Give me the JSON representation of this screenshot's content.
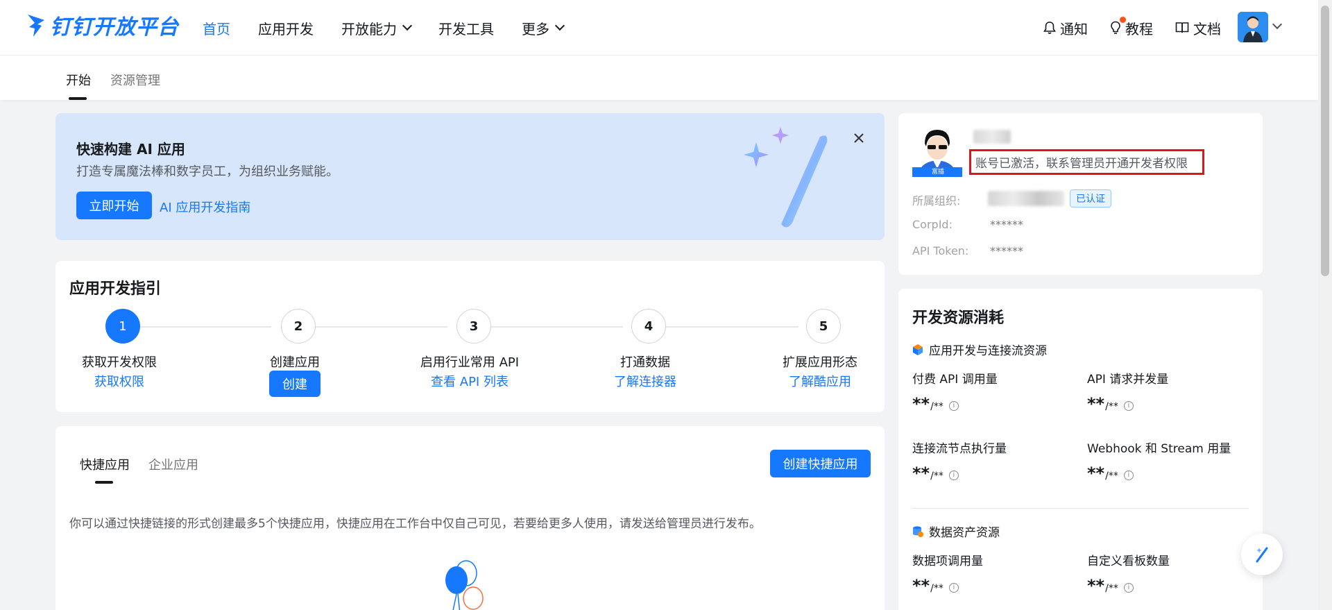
{
  "brand": {
    "name": "钉钉开放平台"
  },
  "nav": {
    "items": [
      {
        "label": "首页",
        "active": true
      },
      {
        "label": "应用开发"
      },
      {
        "label": "开放能力"
      },
      {
        "label": "开发工具"
      },
      {
        "label": "更多"
      }
    ],
    "right": {
      "notify": "通知",
      "tutorial": "教程",
      "docs": "文档"
    }
  },
  "subnav": {
    "tabs": [
      "开始",
      "资源管理"
    ]
  },
  "banner": {
    "title": "快速构建 AI 应用",
    "desc": "打造专属魔法棒和数字员工，为组织业务赋能。",
    "start_btn": "立即开始",
    "guide_link": "AI 应用开发指南"
  },
  "guide": {
    "title": "应用开发指引",
    "steps": [
      {
        "num": "1",
        "label": "获取开发权限",
        "action": "获取权限"
      },
      {
        "num": "2",
        "label": "创建应用",
        "action": "创建"
      },
      {
        "num": "3",
        "label": "启用行业常用 API",
        "action": "查看 API 列表"
      },
      {
        "num": "4",
        "label": "打通数据",
        "action": "了解连接器"
      },
      {
        "num": "5",
        "label": "扩展应用形态",
        "action": "了解酷应用"
      }
    ]
  },
  "quick": {
    "tabs": [
      "快捷应用",
      "企业应用"
    ],
    "create_btn": "创建快捷应用",
    "desc": "你可以通过快捷链接的形式创建最多5个快捷应用，快捷应用在工作台中仅自己可见，若要给更多人使用，请发送给管理员进行发布。"
  },
  "profile": {
    "avatar_tag": "富插",
    "status": "账号已激活，联系管理员开通开发者权限",
    "org_label": "所属组织:",
    "verified": "已认证",
    "corpid_label": "CorpId:",
    "corpid_value": "******",
    "token_label": "API Token:",
    "token_value": "******"
  },
  "resources": {
    "title": "开发资源消耗",
    "section1": "应用开发与连接流资源",
    "metrics1": [
      {
        "label": "付费 API 调用量",
        "value": "**",
        "total": "/**"
      },
      {
        "label": "API 请求并发量",
        "value": "**",
        "total": "/**"
      },
      {
        "label": "连接流节点执行量",
        "value": "**",
        "total": "/**"
      },
      {
        "label": "Webhook 和 Stream 用量",
        "value": "**",
        "total": "/**"
      }
    ],
    "section2": "数据资产资源",
    "metrics2": [
      {
        "label": "数据项调用量",
        "value": "**",
        "total": "/**"
      },
      {
        "label": "自定义看板数量",
        "value": "**",
        "total": "/**"
      }
    ],
    "info_glyph": "i"
  },
  "colors": {
    "primary": "#1677ff",
    "banner_bg": "#d8e6fb",
    "highlight": "#e0141e"
  }
}
